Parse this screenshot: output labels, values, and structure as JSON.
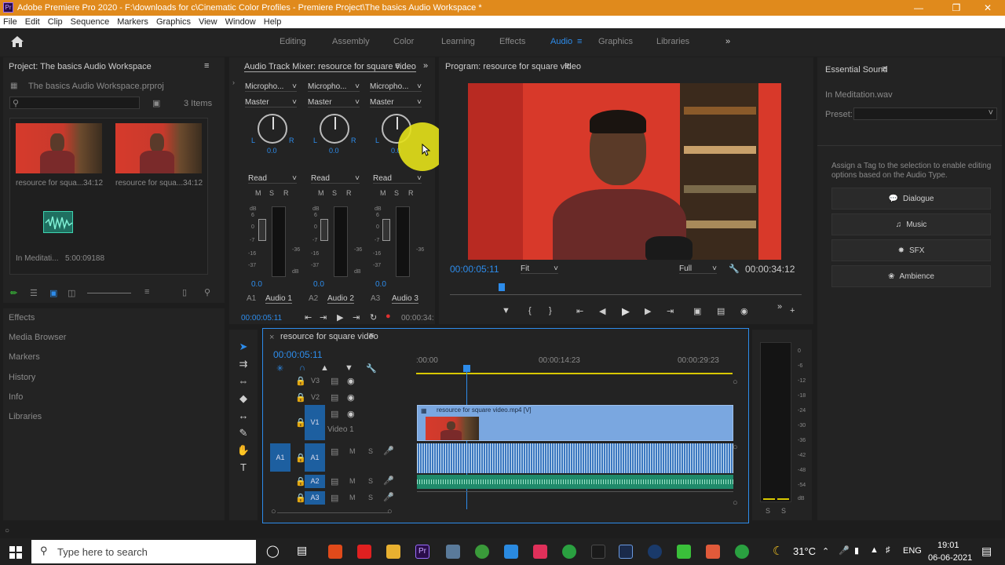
{
  "window": {
    "title": "Adobe Premiere Pro 2020 - F:\\downloads for c\\Cinematic Color Profiles - Premiere Project\\The basics Audio Workspace *",
    "logo": "Pr"
  },
  "menu": [
    "File",
    "Edit",
    "Clip",
    "Sequence",
    "Markers",
    "Graphics",
    "View",
    "Window",
    "Help"
  ],
  "workspaces": [
    "Editing",
    "Assembly",
    "Color",
    "Learning",
    "Effects",
    "Audio",
    "Graphics",
    "Libraries"
  ],
  "active_workspace": "Audio",
  "project": {
    "title": "Project: The basics Audio Workspace",
    "file": "The basics Audio Workspace.prproj",
    "items_count": "3 Items",
    "items": [
      {
        "name": "resource for squa...",
        "duration": "34:12"
      },
      {
        "name": "resource for squa...",
        "duration": "34:12"
      },
      {
        "name": "In Meditati...",
        "duration": "5:00:09188"
      }
    ]
  },
  "side_panels": [
    "Effects",
    "Media Browser",
    "Markers",
    "History",
    "Info",
    "Libraries"
  ],
  "mixer": {
    "title": "Audio Track Mixer: resource for square video",
    "channels": [
      {
        "input": "Micropho...",
        "output": "Master",
        "pan": "0.0",
        "mode": "Read",
        "vol": "0.0",
        "id": "A1",
        "name": "Audio 1"
      },
      {
        "input": "Micropho...",
        "output": "Master",
        "pan": "0.0",
        "mode": "Read",
        "vol": "0.0",
        "id": "A2",
        "name": "Audio 2"
      },
      {
        "input": "Micropho...",
        "output": "Master",
        "pan": "0.0",
        "mode": "Read",
        "vol": "0.0",
        "id": "A3",
        "name": "Audio 3"
      }
    ],
    "msr": [
      "M",
      "S",
      "R"
    ],
    "db_label": "dB",
    "fader_scale": [
      "6",
      "0",
      "-7",
      "-16",
      "-37"
    ],
    "meter_scale": "-36",
    "pan_l": "L",
    "pan_r": "R",
    "timecode_start": "00:00:05:11",
    "timecode_end": "00:00:34:"
  },
  "program": {
    "title": "Program: resource for square video",
    "timecode": "00:00:05:11",
    "fit": "Fit",
    "quality": "Full",
    "duration": "00:00:34:12"
  },
  "essential_sound": {
    "title": "Essential Sound",
    "clip": "In Meditation.wav",
    "preset_label": "Preset:",
    "hint": "Assign a Tag to the selection to enable editing options based on the Audio Type.",
    "types": [
      "Dialogue",
      "Music",
      "SFX",
      "Ambience"
    ]
  },
  "timeline": {
    "tab": "resource for square video",
    "timecode": "00:00:05:11",
    "ruler": [
      ":00:00",
      "00:00:14:23",
      "00:00:29:23"
    ],
    "video_tracks": [
      "V3",
      "V2",
      "V1"
    ],
    "video1_name": "Video 1",
    "audio_tracks": [
      "A1",
      "A2",
      "A3"
    ],
    "source_patch": "A1",
    "clip_name": "resource for square video.mp4 [V]",
    "mute": "M",
    "solo": "S"
  },
  "master_meter": {
    "scale": [
      "0",
      "-6",
      "-12",
      "-18",
      "-24",
      "-30",
      "-36",
      "-42",
      "-48",
      "-54",
      "dB"
    ],
    "solo_left": "S",
    "solo_right": "S"
  },
  "taskbar": {
    "search_placeholder": "Type here to search",
    "temperature": "31°C",
    "language": "ENG",
    "time": "19:01",
    "date": "06-06-2021"
  },
  "colors": {
    "accent": "#2d8ceb",
    "title_bar": "#e08a1c",
    "clip_video": "#7aa7e0",
    "clip_audio": "#3c78c0",
    "clip_audio3": "#1f8a6a",
    "cursor_highlight": "#e6e21a"
  }
}
